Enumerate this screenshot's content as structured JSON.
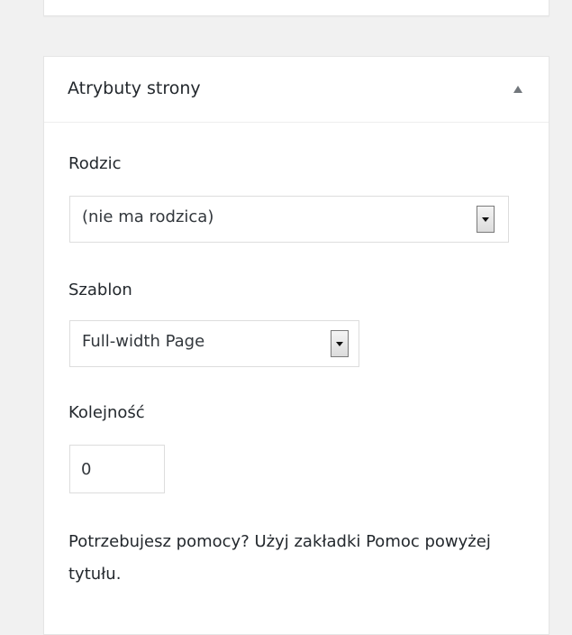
{
  "metabox": {
    "title": "Atrybuty strony",
    "toggle_icon": "arrow-up-icon"
  },
  "parent": {
    "label": "Rodzic",
    "selected": "(nie ma rodzica)"
  },
  "template": {
    "label": "Szablon",
    "selected": "Full-width Page"
  },
  "order": {
    "label": "Kolejność",
    "value": "0"
  },
  "help": {
    "text": "Potrzebujesz pomocy? Użyj zakładki Pomoc powyżej tytułu."
  }
}
